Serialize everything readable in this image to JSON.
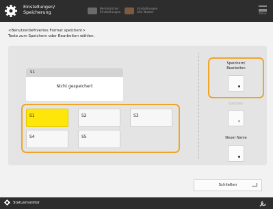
{
  "header": {
    "title_line1": "Einstellungen/",
    "title_line2": "Speicherung",
    "btn1_line1": "Persönlicher",
    "btn1_line2": "Einstellungen",
    "btn2_line1": "Einstellungen",
    "btn2_line2": "Alle Nutzer",
    "menu_label": "Menü"
  },
  "instructions": {
    "line1": "<Benutzerdefiniertes Format speichern>",
    "line2": "Taste zum Speichern oder Bearbeiten wählen."
  },
  "preview": {
    "caption": "S1",
    "value": "Nicht gespeichert"
  },
  "slots": [
    "S1",
    "S2",
    "S3",
    "S4",
    "S5"
  ],
  "selected_slot": "S1",
  "right_panel": {
    "save_edit_line1": "Speichern/",
    "save_edit_line2": "Bearbeiten",
    "delete_label": "Löschen",
    "rename_label": "Neuer Name"
  },
  "close_label": "Schließen",
  "status_monitor_label": "Statusmonitor",
  "colors": {
    "accent": "#f0a428",
    "selected": "#ffe60a",
    "bar": "#2d2d2d"
  },
  "icons": {
    "header": "gear-icon",
    "status": "status-monitor-icon",
    "tools": "tools-icon"
  }
}
